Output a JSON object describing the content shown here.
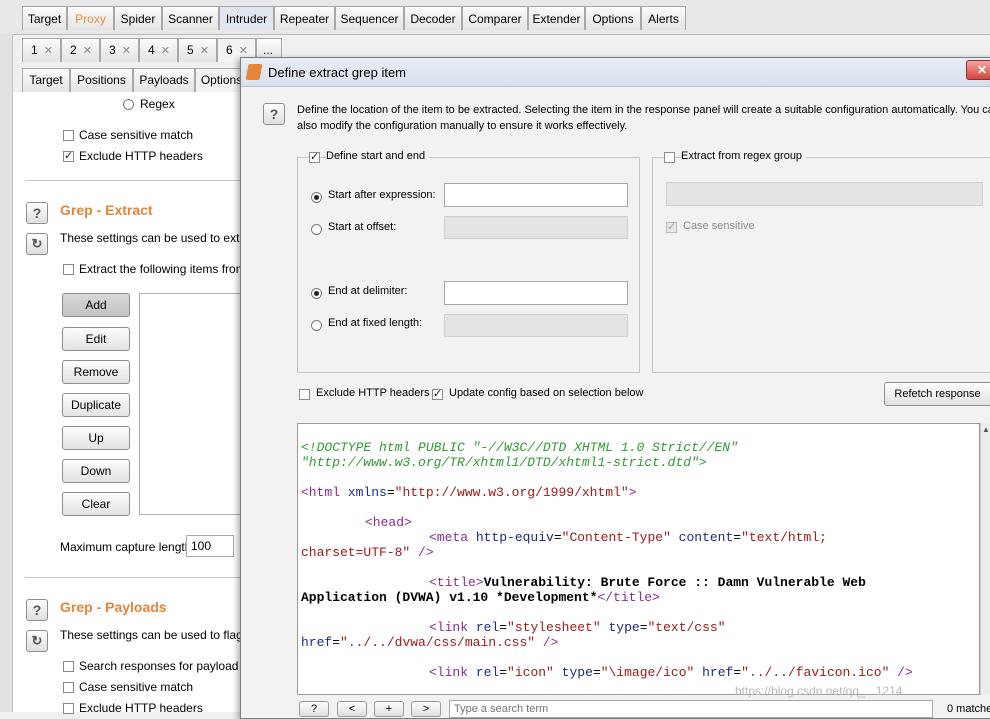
{
  "top_tabs": [
    "Target",
    "Proxy",
    "Spider",
    "Scanner",
    "Intruder",
    "Repeater",
    "Sequencer",
    "Decoder",
    "Comparer",
    "Extender",
    "Options",
    "Alerts"
  ],
  "attack_tabs": [
    "1",
    "2",
    "3",
    "4",
    "5",
    "6",
    "..."
  ],
  "intruder_subtabs": [
    "Target",
    "Positions",
    "Payloads",
    "Options"
  ],
  "left": {
    "regex_label": "Regex",
    "case_sensitive_match": "Case sensitive match",
    "exclude_http_headers": "Exclude HTTP headers",
    "grep_extract_title": "Grep - Extract",
    "grep_extract_desc": "These settings can be used to extrac",
    "extract_following": "Extract the following items from r",
    "buttons": [
      "Add",
      "Edit",
      "Remove",
      "Duplicate",
      "Up",
      "Down",
      "Clear"
    ],
    "max_capture_label": "Maximum capture length:",
    "max_capture_value": "100",
    "grep_payloads_title": "Grep - Payloads",
    "grep_payloads_desc": "These settings can be used to flag re",
    "search_responses": "Search responses for payload st",
    "case_sensitive_match2": "Case sensitive match",
    "exclude_http_headers2": "Exclude HTTP headers"
  },
  "dialog": {
    "title": "Define extract grep item",
    "close_glyph": "✕",
    "description_line1": "Define the location of the item to be extracted. Selecting the item in the response panel will create a suitable configuration automatically. You car",
    "description_line2": "also modify the configuration manually to ensure it works effectively.",
    "define_start_end": "Define start and end",
    "start_after_expression": "Start after expression:",
    "start_at_offset": "Start at offset:",
    "end_at_delimiter": "End at delimiter:",
    "end_at_fixed_length": "End at fixed length:",
    "extract_from_regex_group": "Extract from regex group",
    "case_sensitive": "Case sensitive",
    "exclude_http_headers": "Exclude HTTP headers",
    "update_config": "Update config based on selection below",
    "refetch_response": "Refetch response",
    "search_placeholder": "Type a search term",
    "matches": "0 matche"
  },
  "code_lines": {
    "l1": "<!DOCTYPE html PUBLIC \"-//W3C//DTD XHTML 1.0 Strict//EN\"",
    "l2": "\"http://www.w3.org/TR/xhtml1/DTD/xhtml1-strict.dtd\">",
    "l3_tag": "<html",
    "l3_attr": " xmlns",
    "l3_eq": "=",
    "l3_val": "\"http://www.w3.org/1999/xhtml\"",
    "l3_end": ">",
    "l4": "<head>",
    "l5_tag": "<meta",
    "l5_attr1": " http-equiv",
    "l5_val1": "\"Content-Type\"",
    "l5_attr2": " content",
    "l5_val2": "\"text/html;",
    "l6_val": "charset=UTF-8\"",
    "l6_end": " />",
    "l7_tag": "<title>",
    "l7_text": "Vulnerability: Brute Force :: Damn Vulnerable Web",
    "l8_text": "Application (DVWA) v1.10 *Development*",
    "l8_end": "</title>",
    "l9_tag": "<link",
    "l9_attr1": " rel",
    "l9_val1": "\"stylesheet\"",
    "l9_attr2": " type",
    "l9_val2": "\"text/css\"",
    "l10_attr": "href",
    "l10_val": "\"../../dvwa/css/main.css\"",
    "l10_end": " />",
    "l11_tag": "<link",
    "l11_attr1": " rel",
    "l11_val1": "\"icon\"",
    "l11_attr2": " type",
    "l11_val2": "\"\\image/ico\"",
    "l11_attr3": " href",
    "l11_val3": "\"../../favicon.ico\"",
    "l11_end": " />"
  },
  "nav_buttons": [
    "?",
    "<",
    "+",
    ">"
  ],
  "watermark": "https://blog.csdn.net/qq_...1214"
}
